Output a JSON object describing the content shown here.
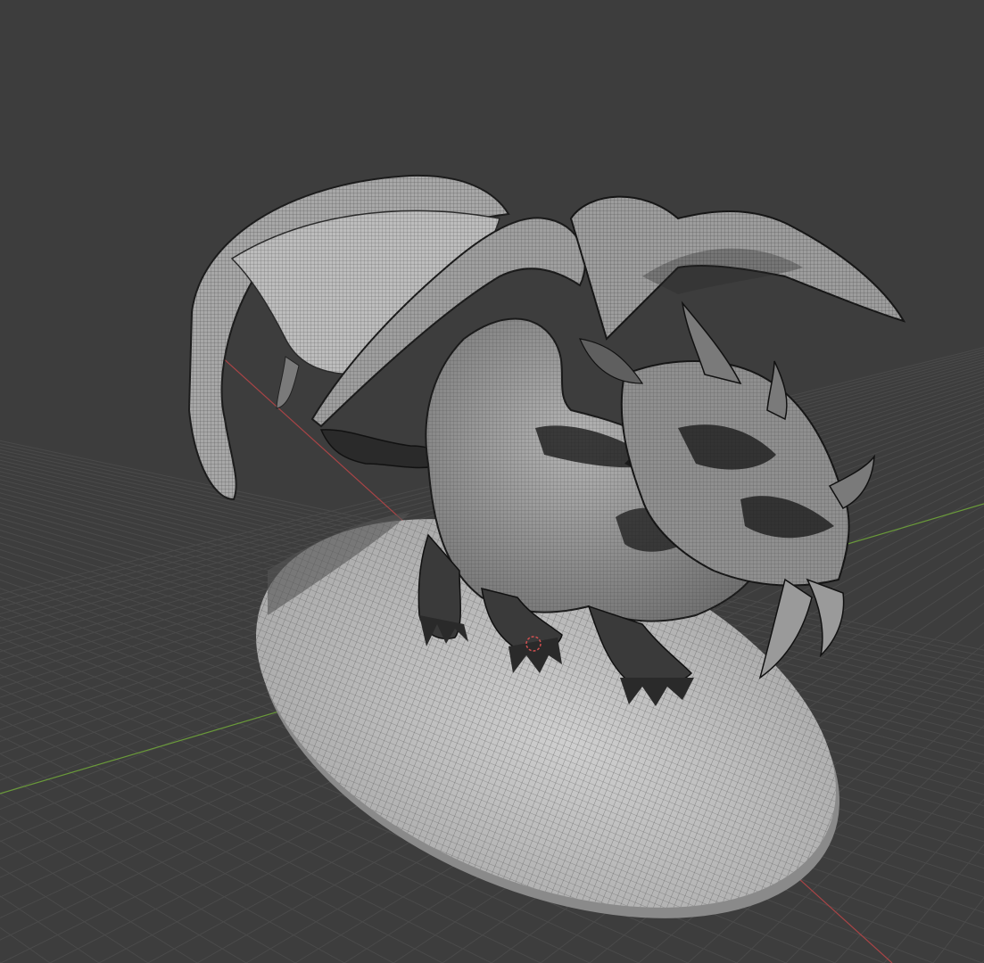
{
  "viewport": {
    "background": "#3d3d3d",
    "grid_color": "#4a4a4a",
    "x_axis_color": "#a84446",
    "y_axis_color": "#6a9a3a"
  },
  "model": {
    "base_fill": "#c4c4c4",
    "body_fill": "#9a9a9a",
    "wing_fill": "#b3b3b3",
    "dark_patch": "#1c1c1c"
  }
}
